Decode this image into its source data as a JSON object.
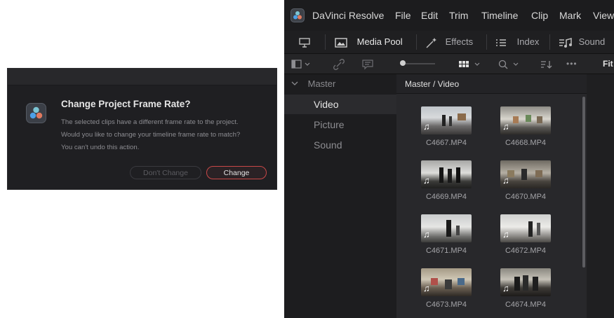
{
  "dialog": {
    "title": "Change Project Frame Rate?",
    "message": "The selected clips have a different frame rate to the project. Would you like to change your timeline frame rate to match? You can't undo this action.",
    "dont_change_label": "Don't Change",
    "change_label": "Change"
  },
  "menubar": {
    "app_name": "DaVinci Resolve",
    "items": [
      "File",
      "Edit",
      "Trim",
      "Timeline",
      "Clip",
      "Mark",
      "View"
    ]
  },
  "toolbar": {
    "media_pool": "Media Pool",
    "effects": "Effects",
    "index": "Index",
    "sound": "Sound"
  },
  "ctrlbar": {
    "zoom_label": "Fit",
    "more": "•••"
  },
  "sidebar": {
    "root": "Master",
    "items": [
      "Video",
      "Picture",
      "Sound"
    ],
    "active": "Video"
  },
  "main": {
    "path": "Master / Video",
    "clips": [
      {
        "name": "C4667.MP4"
      },
      {
        "name": "C4668.MP4"
      },
      {
        "name": "C4669.MP4"
      },
      {
        "name": "C4670.MP4"
      },
      {
        "name": "C4671.MP4"
      },
      {
        "name": "C4672.MP4"
      },
      {
        "name": "C4673.MP4"
      },
      {
        "name": "C4674.MP4"
      }
    ]
  },
  "colors": {
    "accent_red": "#c94848",
    "window_bg": "#1a1a1c",
    "panel_bg": "#28282b"
  },
  "icons": [
    "resolve-logo-icon",
    "monitor-icon",
    "media-pool-icon",
    "effects-wand-icon",
    "list-icon",
    "sound-icon",
    "panel-toggle-icon",
    "link-icon",
    "caption-icon",
    "grid-view-icon",
    "search-icon",
    "sort-icon",
    "music-note-icon"
  ]
}
